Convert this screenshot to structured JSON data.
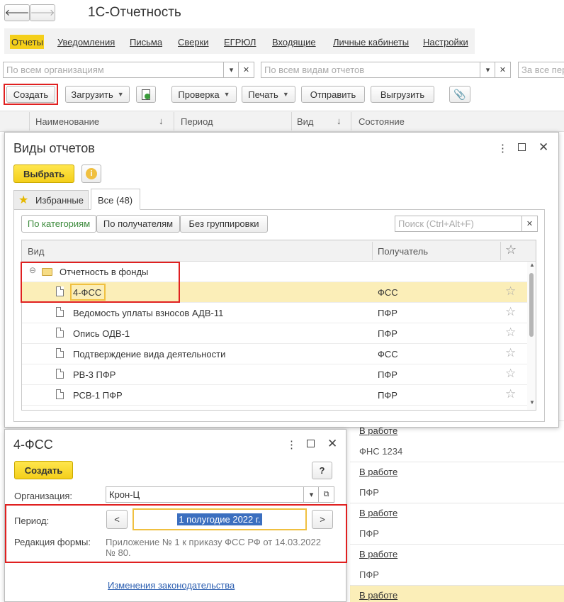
{
  "window": {
    "title": "1С-Отчетность",
    "back_label": "🡐",
    "forward_label": "🡒"
  },
  "menu": {
    "items": [
      "Отчеты",
      "Уведомления",
      "Письма",
      "Сверки",
      "ЕГРЮЛ",
      "Входящие",
      "Личные кабинеты",
      "Настройки"
    ]
  },
  "filters": {
    "org_placeholder": "По всем организациям",
    "kind_placeholder": "По всем видам отчетов",
    "period_placeholder": "За все пер"
  },
  "toolbar": {
    "create": "Создать",
    "load": "Загрузить",
    "check": "Проверка",
    "print": "Печать",
    "send": "Отправить",
    "export": "Выгрузить"
  },
  "list_header": {
    "name": "Наименование",
    "period": "Период",
    "kind": "Вид",
    "state": "Состояние"
  },
  "background_status": [
    {
      "text": "В работе",
      "style": "link"
    },
    {
      "text": "ФНС 1234",
      "style": "grey"
    },
    {
      "text": "В работе",
      "style": "link"
    },
    {
      "text": "ПФР",
      "style": "grey"
    },
    {
      "text": "В работе",
      "style": "link"
    },
    {
      "text": "ПФР",
      "style": "grey"
    },
    {
      "text": "В работе",
      "style": "link"
    },
    {
      "text": "ПФР",
      "style": "grey"
    },
    {
      "text": "В работе",
      "style": "link"
    }
  ],
  "report_types_dialog": {
    "title": "Виды отчетов",
    "choose": "Выбрать",
    "tabs": {
      "favorites": "Избранные",
      "all": "Все (48)"
    },
    "grouping": {
      "by_category": "По категориям",
      "by_recipient": "По получателям",
      "no_grouping": "Без группировки"
    },
    "search_placeholder": "Поиск (Ctrl+Alt+F)",
    "columns": {
      "kind": "Вид",
      "recipient": "Получатель"
    },
    "group": "Отчетность в фонды",
    "rows": [
      {
        "name": "4-ФСС",
        "recipient": "ФСС"
      },
      {
        "name": "Ведомость уплаты взносов АДВ-11",
        "recipient": "ПФР"
      },
      {
        "name": "Опись ОДВ-1",
        "recipient": "ПФР"
      },
      {
        "name": "Подтверждение вида деятельности",
        "recipient": "ФСС"
      },
      {
        "name": "РВ-3 ПФР",
        "recipient": "ПФР"
      },
      {
        "name": "РСВ-1 ПФР",
        "recipient": "ПФР"
      }
    ]
  },
  "fss_dialog": {
    "title": "4-ФСС",
    "create": "Создать",
    "help": "?",
    "org_label": "Организация:",
    "org_value": "Крон-Ц",
    "period_label": "Период:",
    "period_value": "1 полугодие 2022 г.",
    "prev": "<",
    "next": ">",
    "edition_label": "Редакция формы:",
    "edition_value": "Приложение № 1 к приказу ФСС РФ от 14.03.2022 № 80.",
    "law_changes": "Изменения законодательства"
  },
  "colors": {
    "accent_yellow": "#f4cf1a",
    "highlight_red": "#e02020",
    "selected_row": "#fbeeb8"
  }
}
